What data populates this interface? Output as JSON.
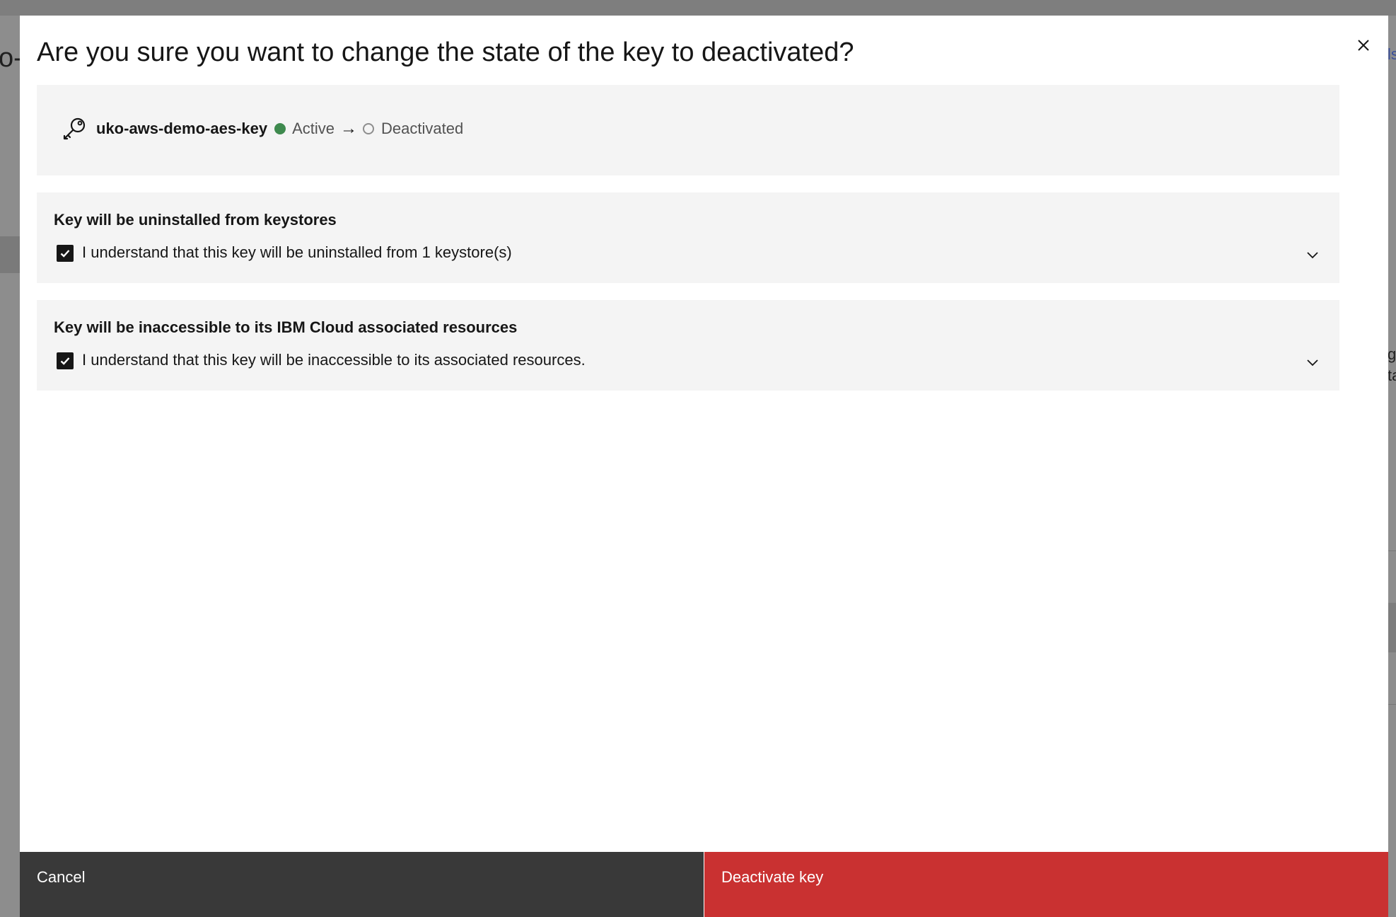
{
  "background": {
    "title_fragment": "o-",
    "link_fragment": "ls",
    "right_text_line1": "g",
    "right_text_line2": "ta"
  },
  "modal": {
    "title": "Are you sure you want to change the state of the key to deactivated?",
    "close_label": "Close",
    "key": {
      "name": "uko-aws-demo-aes-key",
      "current_state": "Active",
      "arrow": "→",
      "target_state": "Deactivated",
      "current_state_color": "#3e8a4e"
    },
    "acknowledgements": [
      {
        "heading": "Key will be uninstalled from keystores",
        "label": "I understand that this key will be uninstalled from 1 keystore(s)",
        "checked": true
      },
      {
        "heading": "Key will be inaccessible to its IBM Cloud associated resources",
        "label": "I understand that this key will be inaccessible to its associated resources.",
        "checked": true
      }
    ],
    "footer": {
      "cancel_label": "Cancel",
      "primary_label": "Deactivate key",
      "primary_color": "#c93131",
      "secondary_color": "#393939"
    }
  },
  "icons": {
    "close": "close-icon",
    "key": "key-icon",
    "checkbox": "checkmark-icon",
    "chevron": "chevron-down-icon"
  }
}
